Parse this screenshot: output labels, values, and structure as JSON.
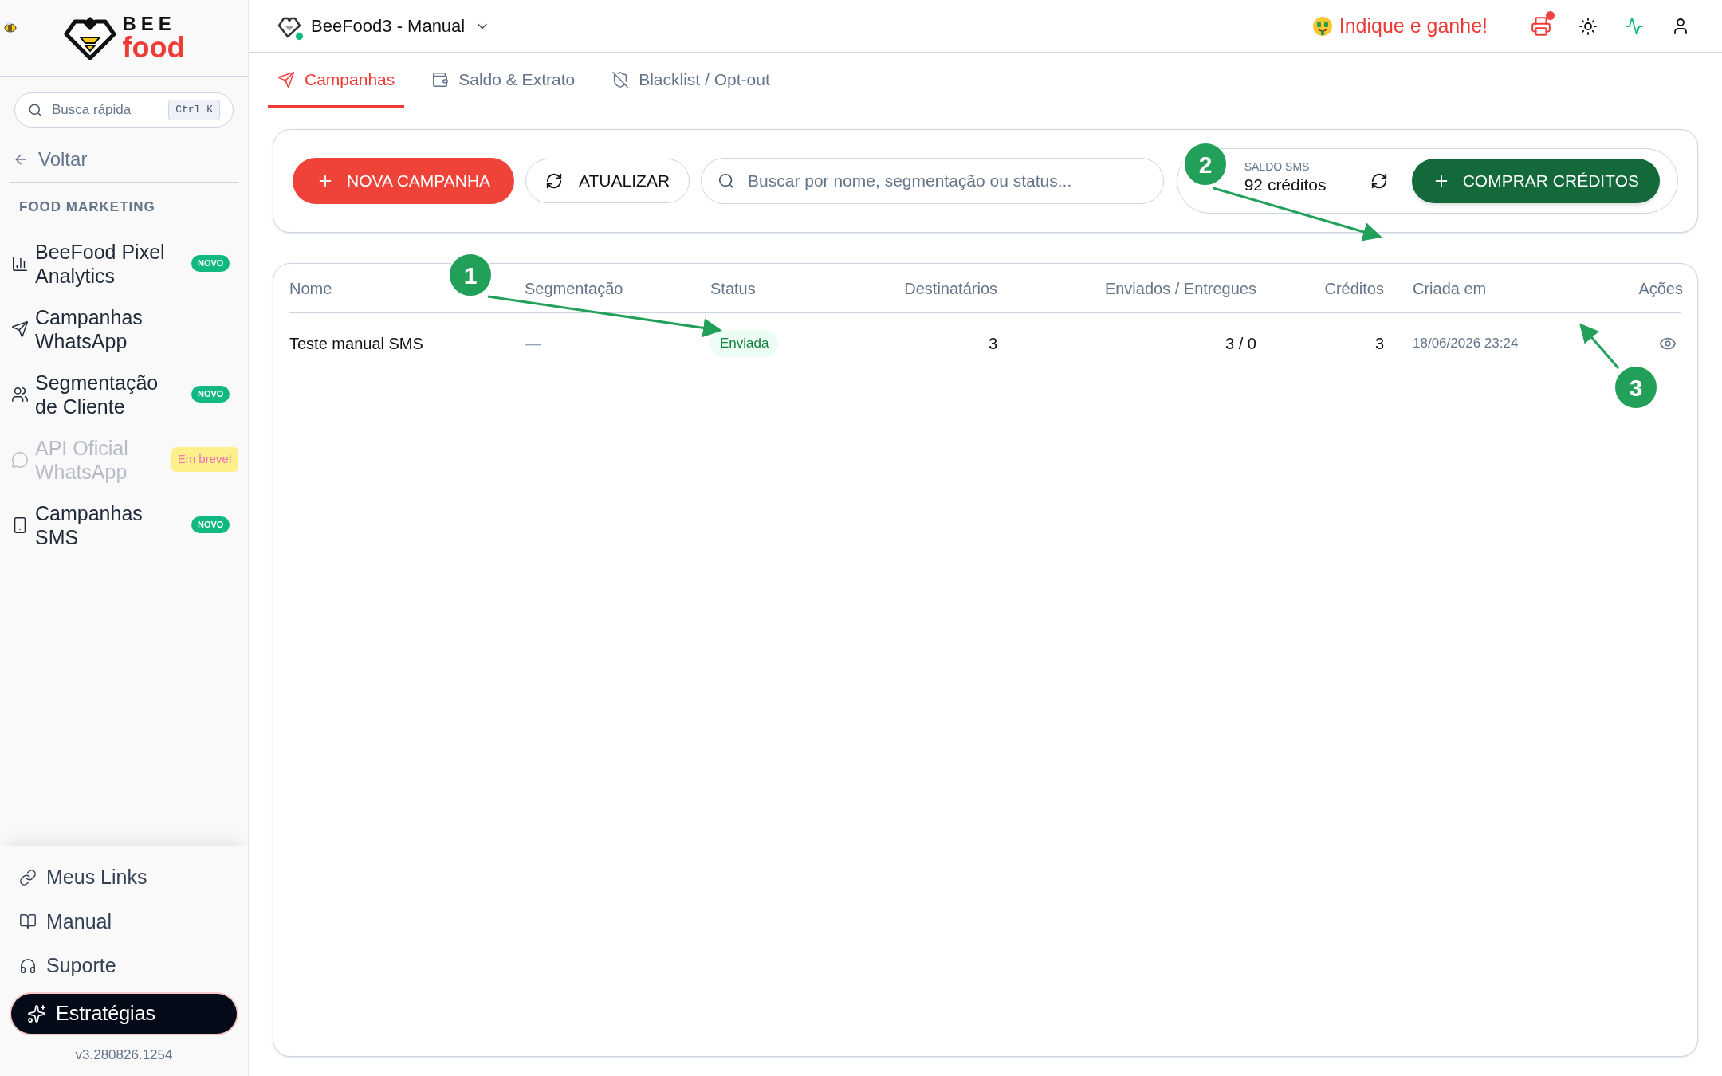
{
  "sidebar": {
    "logo": {
      "line1": "BEE",
      "line2": "food"
    },
    "search": {
      "placeholder": "Busca rápida",
      "shortcut": "Ctrl K"
    },
    "back": "Voltar",
    "section": "FOOD MARKETING",
    "items": [
      {
        "kind": "chart",
        "label": "BeeFood Pixel Analytics",
        "badge": {
          "text": "NOVO",
          "kind": "new"
        },
        "disabled": false
      },
      {
        "kind": "send",
        "label": "Campanhas WhatsApp",
        "disabled": false
      },
      {
        "kind": "users",
        "label": "Segmentação de Cliente",
        "badge": {
          "text": "NOVO",
          "kind": "new"
        },
        "disabled": false
      },
      {
        "kind": "chat",
        "label": "API Oficial WhatsApp",
        "badge": {
          "text": "Em breve!",
          "kind": "soon"
        },
        "disabled": true
      },
      {
        "kind": "phone",
        "label": "Campanhas SMS",
        "badge": {
          "text": "NOVO",
          "kind": "new"
        },
        "disabled": false
      }
    ],
    "footer_links": [
      {
        "kind": "link",
        "label": "Meus Links"
      },
      {
        "kind": "book",
        "label": "Manual"
      },
      {
        "kind": "headset",
        "label": "Suporte"
      }
    ],
    "strategy_button": "Estratégias",
    "version": "v3.280826.1254"
  },
  "header": {
    "store": "BeeFood3 - Manual",
    "store_online": true,
    "referral": "Indique e ganhe!",
    "printer_alert": true
  },
  "tabs": [
    {
      "kind": "send",
      "label": "Campanhas",
      "selected": true
    },
    {
      "kind": "wallet",
      "label": "Saldo & Extrato",
      "selected": false
    },
    {
      "kind": "shield",
      "label": "Blacklist / Opt-out",
      "selected": false
    }
  ],
  "toolbar": {
    "new_button": "NOVA CAMPANHA",
    "refresh_button": "ATUALIZAR",
    "search": {
      "placeholder": "Buscar por nome, segmentação ou status..."
    },
    "balance": {
      "label": "SALDO SMS",
      "value": "92 créditos"
    },
    "buy_button": "COMPRAR CRÉDITOS"
  },
  "table": {
    "columns": [
      "Nome",
      "Segmentação",
      "Status",
      "Destinatários",
      "Enviados / Entregues",
      "Créditos",
      "Criada em",
      "Ações"
    ],
    "rows": [
      {
        "name": "Teste manual SMS",
        "segmentation": "—",
        "status": {
          "text": "Enviada",
          "kind": "sent"
        },
        "recipients": "3",
        "sent_delivered": "3 / 0",
        "credits": "3",
        "created": "18/06/2026 23:24"
      }
    ]
  },
  "annotations": [
    {
      "label": "1"
    },
    {
      "label": "2"
    },
    {
      "label": "3"
    }
  ]
}
